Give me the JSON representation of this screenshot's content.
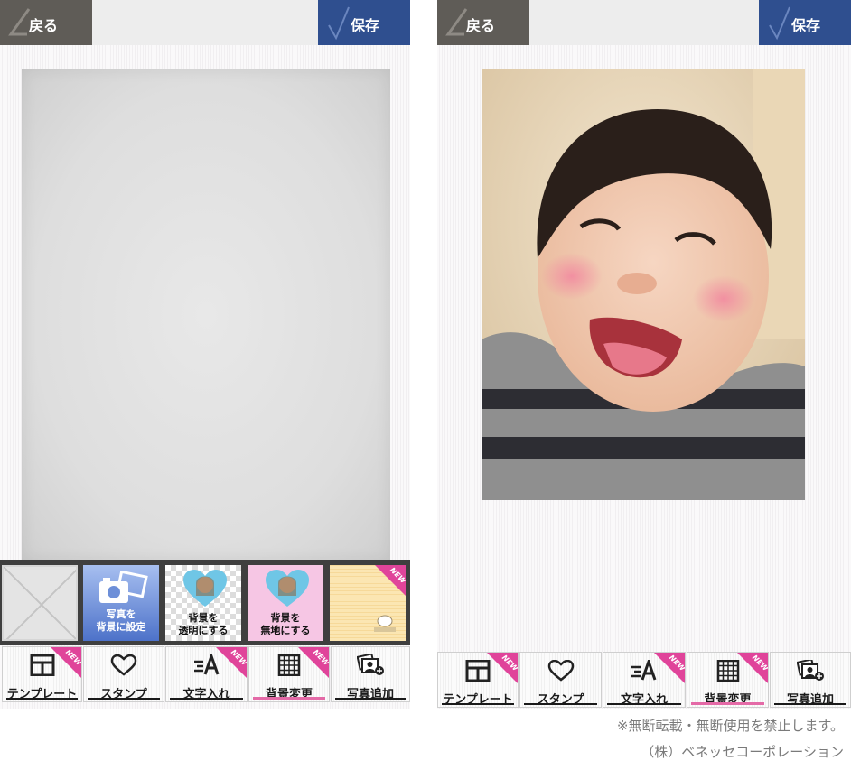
{
  "header": {
    "back_label": "戻る",
    "save_label": "保存"
  },
  "bg_options": [
    {
      "caption": "",
      "icon": "empty-cross"
    },
    {
      "caption_line1": "写真を",
      "caption_line2": "背景に設定",
      "icon": "camera-photo-icon"
    },
    {
      "caption_line1": "背景を",
      "caption_line2": "透明にする",
      "icon": "heart-portrait-icon"
    },
    {
      "caption_line1": "背景を",
      "caption_line2": "無地にする",
      "icon": "heart-portrait-icon"
    },
    {
      "caption": "",
      "icon": "yellow-pattern",
      "badge": "NEW"
    }
  ],
  "toolbar": [
    {
      "label": "テンプレート",
      "icon": "template-icon",
      "badge": "NEW"
    },
    {
      "label": "スタンプ",
      "icon": "heart-icon"
    },
    {
      "label": "文字入れ",
      "icon": "text-icon",
      "badge": "NEW"
    },
    {
      "label": "背景変更",
      "icon": "grid-icon",
      "badge": "NEW",
      "active": true
    },
    {
      "label": "写真追加",
      "icon": "add-photo-icon"
    }
  ],
  "new_badge": "NEW",
  "footer": {
    "notice": "※無断転載・無断使用を禁止します。",
    "company": "（株）ベネッセコーポレーション"
  },
  "colors": {
    "back": "#5f5c57",
    "save": "#2f4f8f",
    "badge": "#e0449a",
    "active_underline": "#e46aa7"
  }
}
